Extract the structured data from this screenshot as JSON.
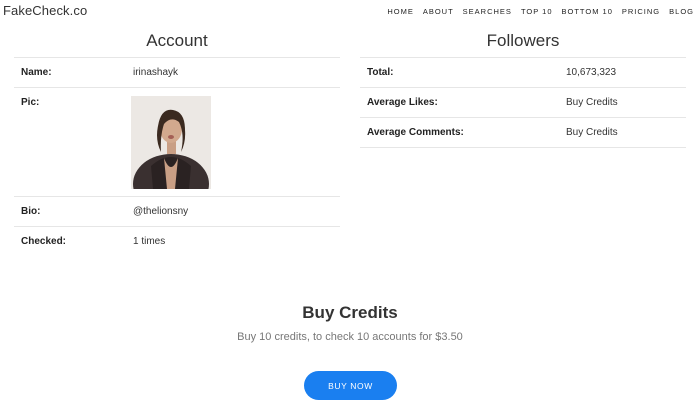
{
  "brand": "FakeCheck.co",
  "nav": [
    "HOME",
    "ABOUT",
    "SEARCHES",
    "TOP 10",
    "BOTTOM 10",
    "PRICING",
    "BLOG"
  ],
  "account": {
    "title": "Account",
    "name_label": "Name:",
    "name_value": "irinashayk",
    "pic_label": "Pic:",
    "bio_label": "Bio:",
    "bio_value": "@thelionsny",
    "checked_label": "Checked:",
    "checked_value": "1 times"
  },
  "followers": {
    "title": "Followers",
    "total_label": "Total:",
    "total_value": "10,673,323",
    "likes_label": "Average Likes:",
    "likes_value": "Buy Credits",
    "comments_label": "Average Comments:",
    "comments_value": "Buy Credits"
  },
  "buy": {
    "title": "Buy Credits",
    "description": "Buy 10 credits, to check 10 accounts for $3.50",
    "button": "BUY NOW"
  },
  "colors": {
    "accent": "#1a7ff0"
  }
}
